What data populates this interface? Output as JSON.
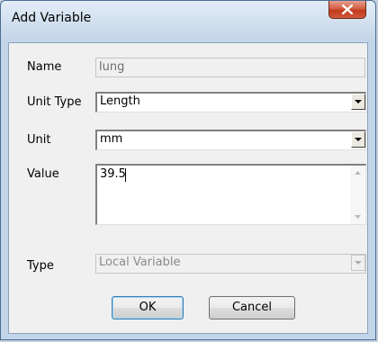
{
  "dialog": {
    "title": "Add Variable",
    "close_glyph": "close-icon"
  },
  "form": {
    "name_label": "Name",
    "name_value": "lung",
    "unit_type_label": "Unit Type",
    "unit_type_value": "Length",
    "unit_label": "Unit",
    "unit_value": "mm",
    "value_label": "Value",
    "value_text": "39.5",
    "type_label": "Type",
    "type_value": "Local Variable"
  },
  "buttons": {
    "ok": "OK",
    "cancel": "Cancel"
  },
  "colors": {
    "frame": "#c3d5e8",
    "close": "#c2391b",
    "client": "#f0f0f0"
  }
}
